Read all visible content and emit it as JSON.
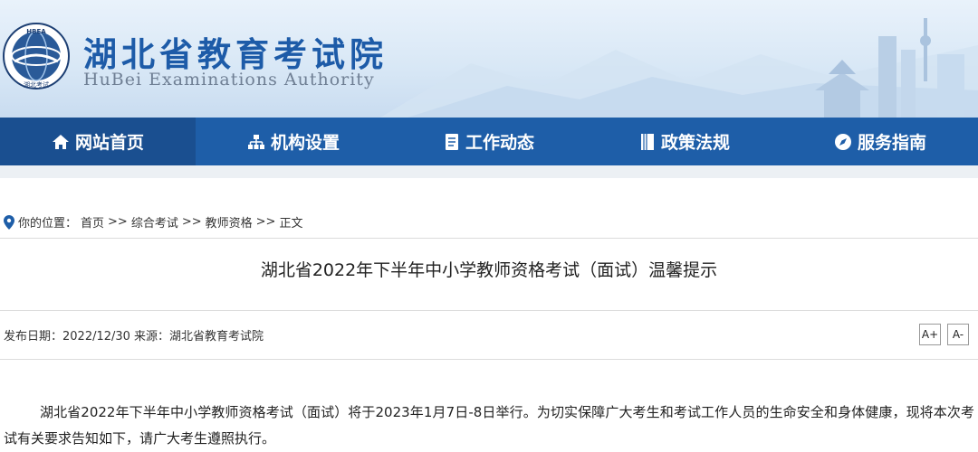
{
  "header": {
    "logo_text": "HBEA 湖北考试",
    "title": "湖北省教育考试院",
    "subtitle": "HuBei Examinations Authority"
  },
  "nav": {
    "items": [
      {
        "label": "网站首页",
        "icon": "home-icon",
        "active": true
      },
      {
        "label": "机构设置",
        "icon": "org-chart-icon",
        "active": false
      },
      {
        "label": "工作动态",
        "icon": "document-icon",
        "active": false
      },
      {
        "label": "政策法规",
        "icon": "book-icon",
        "active": false
      },
      {
        "label": "服务指南",
        "icon": "compass-icon",
        "active": false
      }
    ]
  },
  "breadcrumb": {
    "prefix": "你的位置：",
    "items": [
      "首页",
      "综合考试",
      "教师资格",
      "正文"
    ],
    "separator": ">>"
  },
  "article": {
    "title": "湖北省2022年下半年中小学教师资格考试（面试）温馨提示",
    "meta": "发布日期：2022/12/30 来源：湖北省教育考试院",
    "font_increase": "A+",
    "font_decrease": "A-",
    "paragraph": "湖北省2022年下半年中小学教师资格考试（面试）将于2023年1月7日-8日举行。为切实保障广大考生和考试工作人员的生命安全和身体健康，现将本次考试有关要求告知如下，请广大考生遵照执行。"
  },
  "colors": {
    "nav_bg": "#1e5ea8",
    "nav_active": "#1a4f90",
    "title_blue": "#1d5ba8"
  }
}
